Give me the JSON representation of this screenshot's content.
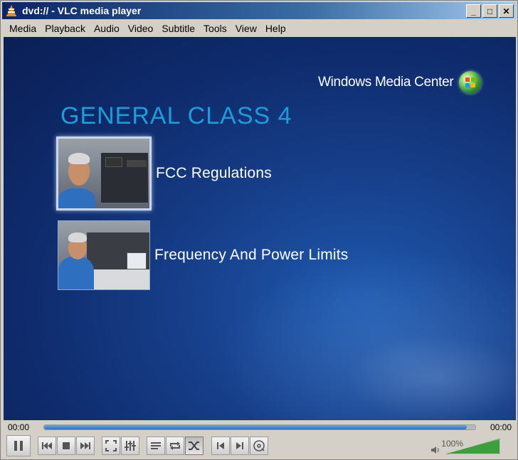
{
  "window": {
    "title": "dvd:// - VLC media player",
    "buttons": {
      "minimize": "_",
      "maximize": "□",
      "close": "✕"
    }
  },
  "menu": [
    {
      "label": "Media"
    },
    {
      "label": "Playback"
    },
    {
      "label": "Audio"
    },
    {
      "label": "Video"
    },
    {
      "label": "Subtitle"
    },
    {
      "label": "Tools"
    },
    {
      "label": "View"
    },
    {
      "label": "Help"
    }
  ],
  "video": {
    "brand": "Windows Media Center",
    "heading": "GENERAL CLASS 4",
    "chapters": [
      {
        "label": "FCC Regulations",
        "selected": true
      },
      {
        "label": "Frequency And Power Limits",
        "selected": false
      }
    ]
  },
  "seek": {
    "elapsed": "00:00",
    "total": "00:00",
    "progress_percent": 98
  },
  "controls": {
    "buttons": [
      "pause-icon",
      "previous-icon",
      "stop-icon",
      "next-icon",
      "fullscreen-icon",
      "equalizer-icon",
      "playlist-icon",
      "loop-icon",
      "shuffle-icon",
      "frame-back-icon",
      "frame-next-icon",
      "dvd-menu-icon"
    ],
    "volume_label": "100%",
    "volume_percent": 100
  },
  "colors": {
    "title_accent": "#1a9ed8",
    "seek_fill": "#2b6fc7",
    "volume_fill": "#3aa03a"
  }
}
